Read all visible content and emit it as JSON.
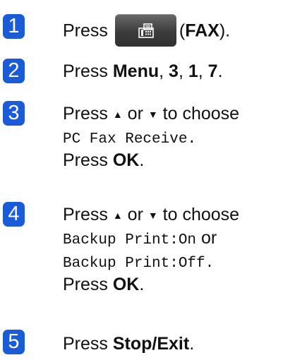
{
  "colors": {
    "badge": "#1b5bd8",
    "fax_button": "#3c3c3c"
  },
  "steps": [
    {
      "number": "1",
      "prefix": "Press",
      "button_icon": "fax-icon",
      "paren_open": "(",
      "bold": "FAX",
      "paren_close": ")."
    },
    {
      "number": "2",
      "prefix": "Press ",
      "b1": "Menu",
      "sep1": ", ",
      "b2": "3",
      "sep2": ", ",
      "b3": "1",
      "sep3": ", ",
      "b4": "7",
      "end": "."
    },
    {
      "number": "3",
      "l1_prefix": "Press ",
      "up_arrow": "▲",
      "or": " or ",
      "down_arrow": "▼",
      "l1_suffix": " to choose",
      "mono": "PC Fax Receive",
      "mono_end": ".",
      "l3_prefix": "Press ",
      "l3_bold": "OK",
      "l3_end": "."
    },
    {
      "number": "4",
      "l1_prefix": "Press ",
      "up_arrow": "▲",
      "or": " or ",
      "down_arrow": "▼",
      "l1_suffix": " to choose",
      "mono1": "Backup Print:On",
      "mono1_or": " or",
      "mono2": "Backup Print:Off",
      "mono2_end": ".",
      "l4_prefix": "Press ",
      "l4_bold": "OK",
      "l4_end": "."
    },
    {
      "number": "5",
      "prefix": "Press ",
      "bold": "Stop/Exit",
      "end": "."
    }
  ]
}
